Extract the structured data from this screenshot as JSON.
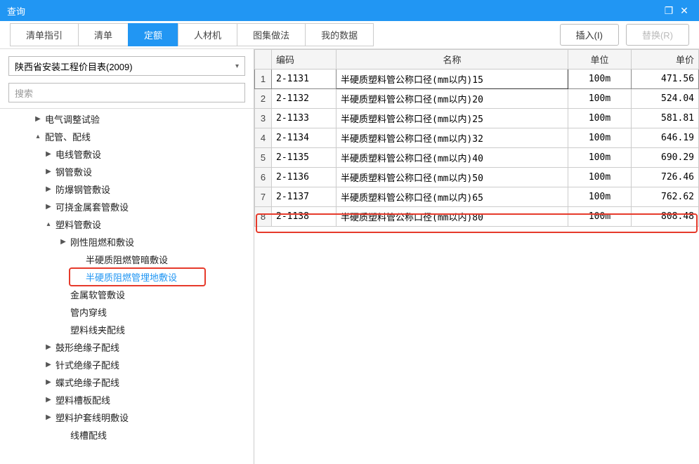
{
  "titlebar": {
    "title": "查询",
    "maximize_icon": "❐",
    "close_icon": "✕"
  },
  "tabs": [
    {
      "label": "清单指引"
    },
    {
      "label": "清单"
    },
    {
      "label": "定额",
      "active": true
    },
    {
      "label": "人材机"
    },
    {
      "label": "图集做法"
    },
    {
      "label": "我的数据"
    }
  ],
  "buttons": {
    "insert": "插入(I)",
    "replace": "替换(R)"
  },
  "dropdown": {
    "value": "陕西省安装工程价目表(2009)"
  },
  "search": {
    "placeholder": "搜索"
  },
  "tree": [
    {
      "label": "电气调整试验",
      "level": 1,
      "toggle": "▶"
    },
    {
      "label": "配管、配线",
      "level": 1,
      "toggle": "▴"
    },
    {
      "label": "电线管敷设",
      "level": 2,
      "toggle": "▶"
    },
    {
      "label": "钢管敷设",
      "level": 2,
      "toggle": "▶"
    },
    {
      "label": "防爆钢管敷设",
      "level": 2,
      "toggle": "▶"
    },
    {
      "label": "可挠金属套管敷设",
      "level": 2,
      "toggle": "▶"
    },
    {
      "label": "塑料管敷设",
      "level": 2,
      "toggle": "▴"
    },
    {
      "label": "刚性阻燃和敷设",
      "level": 3,
      "toggle": "▶"
    },
    {
      "label": "半硬质阻燃管暗敷设",
      "level": 4,
      "toggle": ""
    },
    {
      "label": "半硬质阻燃管埋地敷设",
      "level": 4,
      "toggle": "",
      "selected": true,
      "highlighted": true
    },
    {
      "label": "金属软管敷设",
      "level": 3,
      "toggle": ""
    },
    {
      "label": "管内穿线",
      "level": 3,
      "toggle": ""
    },
    {
      "label": "塑料线夹配线",
      "level": 3,
      "toggle": ""
    },
    {
      "label": "鼓形绝缘子配线",
      "level": 2,
      "toggle": "▶"
    },
    {
      "label": "针式绝缘子配线",
      "level": 2,
      "toggle": "▶"
    },
    {
      "label": "蝶式绝缘子配线",
      "level": 2,
      "toggle": "▶"
    },
    {
      "label": "塑料槽板配线",
      "level": 2,
      "toggle": "▶"
    },
    {
      "label": "塑料护套线明敷设",
      "level": 2,
      "toggle": "▶"
    },
    {
      "label": "线槽配线",
      "level": 3,
      "toggle": ""
    }
  ],
  "grid": {
    "headers": {
      "code": "编码",
      "name": "名称",
      "unit": "单位",
      "price": "单价"
    },
    "rows": [
      {
        "n": "1",
        "code": "2-1131",
        "name": "半硬质塑料管公称口径(mm以内)15",
        "unit": "100m",
        "price": "471.56",
        "sel": true
      },
      {
        "n": "2",
        "code": "2-1132",
        "name": "半硬质塑料管公称口径(mm以内)20",
        "unit": "100m",
        "price": "524.04"
      },
      {
        "n": "3",
        "code": "2-1133",
        "name": "半硬质塑料管公称口径(mm以内)25",
        "unit": "100m",
        "price": "581.81"
      },
      {
        "n": "4",
        "code": "2-1134",
        "name": "半硬质塑料管公称口径(mm以内)32",
        "unit": "100m",
        "price": "646.19"
      },
      {
        "n": "5",
        "code": "2-1135",
        "name": "半硬质塑料管公称口径(mm以内)40",
        "unit": "100m",
        "price": "690.29"
      },
      {
        "n": "6",
        "code": "2-1136",
        "name": "半硬质塑料管公称口径(mm以内)50",
        "unit": "100m",
        "price": "726.46"
      },
      {
        "n": "7",
        "code": "2-1137",
        "name": "半硬质塑料管公称口径(mm以内)65",
        "unit": "100m",
        "price": "762.62"
      },
      {
        "n": "8",
        "code": "2-1138",
        "name": "半硬质塑料管公称口径(mm以内)80",
        "unit": "100m",
        "price": "808.48",
        "hl": true
      }
    ]
  }
}
